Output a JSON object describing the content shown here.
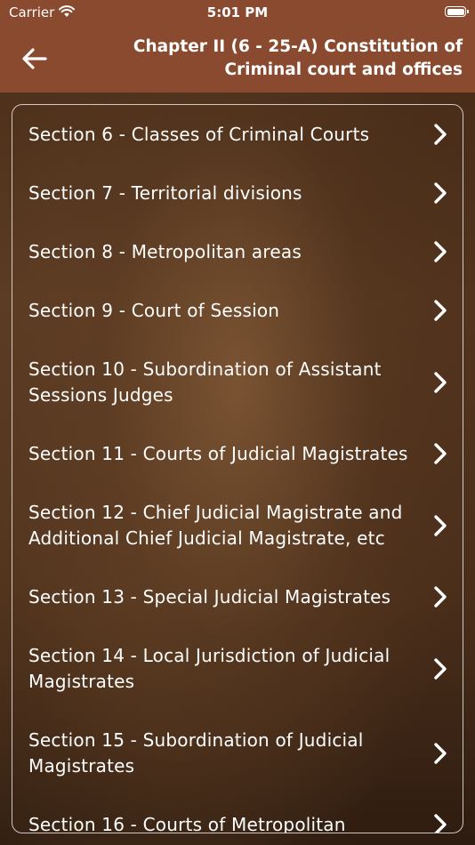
{
  "status_bar": {
    "carrier": "Carrier",
    "time": "5:01 PM"
  },
  "nav": {
    "back_icon": "arrow-left-icon",
    "title": "Chapter II (6 - 25-A) Constitution of Criminal court and offices"
  },
  "sections": [
    {
      "label": "Section 6 - Classes of Criminal Courts"
    },
    {
      "label": "Section 7 - Territorial divisions"
    },
    {
      "label": "Section 8 - Metropolitan areas"
    },
    {
      "label": "Section 9 - Court of Session"
    },
    {
      "label": "Section 10 - Subordination of Assistant Sessions Judges"
    },
    {
      "label": "Section 11 - Courts of Judicial Magistrates"
    },
    {
      "label": "Section 12 - Chief Judicial Magistrate and Additional Chief Judicial Magistrate, etc"
    },
    {
      "label": "Section 13 - Special Judicial Magistrates"
    },
    {
      "label": "Section 14 - Local Jurisdiction of Judicial Magistrates"
    },
    {
      "label": "Section 15 - Subordination of Judicial Magistrates"
    },
    {
      "label": "Section 16 - Courts of Metropolitan"
    }
  ],
  "colors": {
    "bar": "#8a4a2f",
    "text": "#ffffff"
  }
}
